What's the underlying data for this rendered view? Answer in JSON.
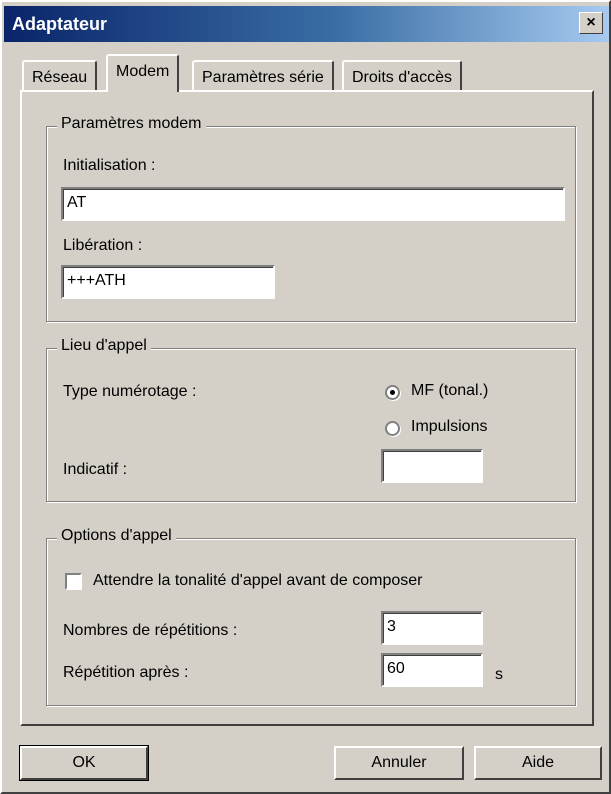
{
  "window": {
    "title": "Adaptateur",
    "close": "×"
  },
  "tabs": [
    {
      "label": "Réseau"
    },
    {
      "label": "Modem",
      "active": true
    },
    {
      "label": "Paramètres série"
    },
    {
      "label": "Droits d'accès"
    }
  ],
  "modem_group": {
    "title": "Paramètres modem",
    "init_label": "Initialisation :",
    "init_value": "AT",
    "release_label": "Libération :",
    "release_value": "+++ATH"
  },
  "call_location": {
    "title": "Lieu d'appel",
    "dial_type_label": "Type numérotage :",
    "dial_options": [
      {
        "label": "MF (tonal.)",
        "checked": true
      },
      {
        "label": "Impulsions",
        "checked": false
      }
    ],
    "prefix_label": "Indicatif :",
    "prefix_value": ""
  },
  "call_options": {
    "title": "Options d'appel",
    "wait_dial_tone_label": "Attendre la tonalité d'appel avant de composer",
    "wait_dial_tone_checked": false,
    "retries_label": "Nombres de répétitions :",
    "retries_value": "3",
    "retry_after_label": "Répétition après :",
    "retry_after_value": "60",
    "retry_after_unit": "s"
  },
  "buttons": {
    "ok": "OK",
    "cancel": "Annuler",
    "help": "Aide"
  }
}
